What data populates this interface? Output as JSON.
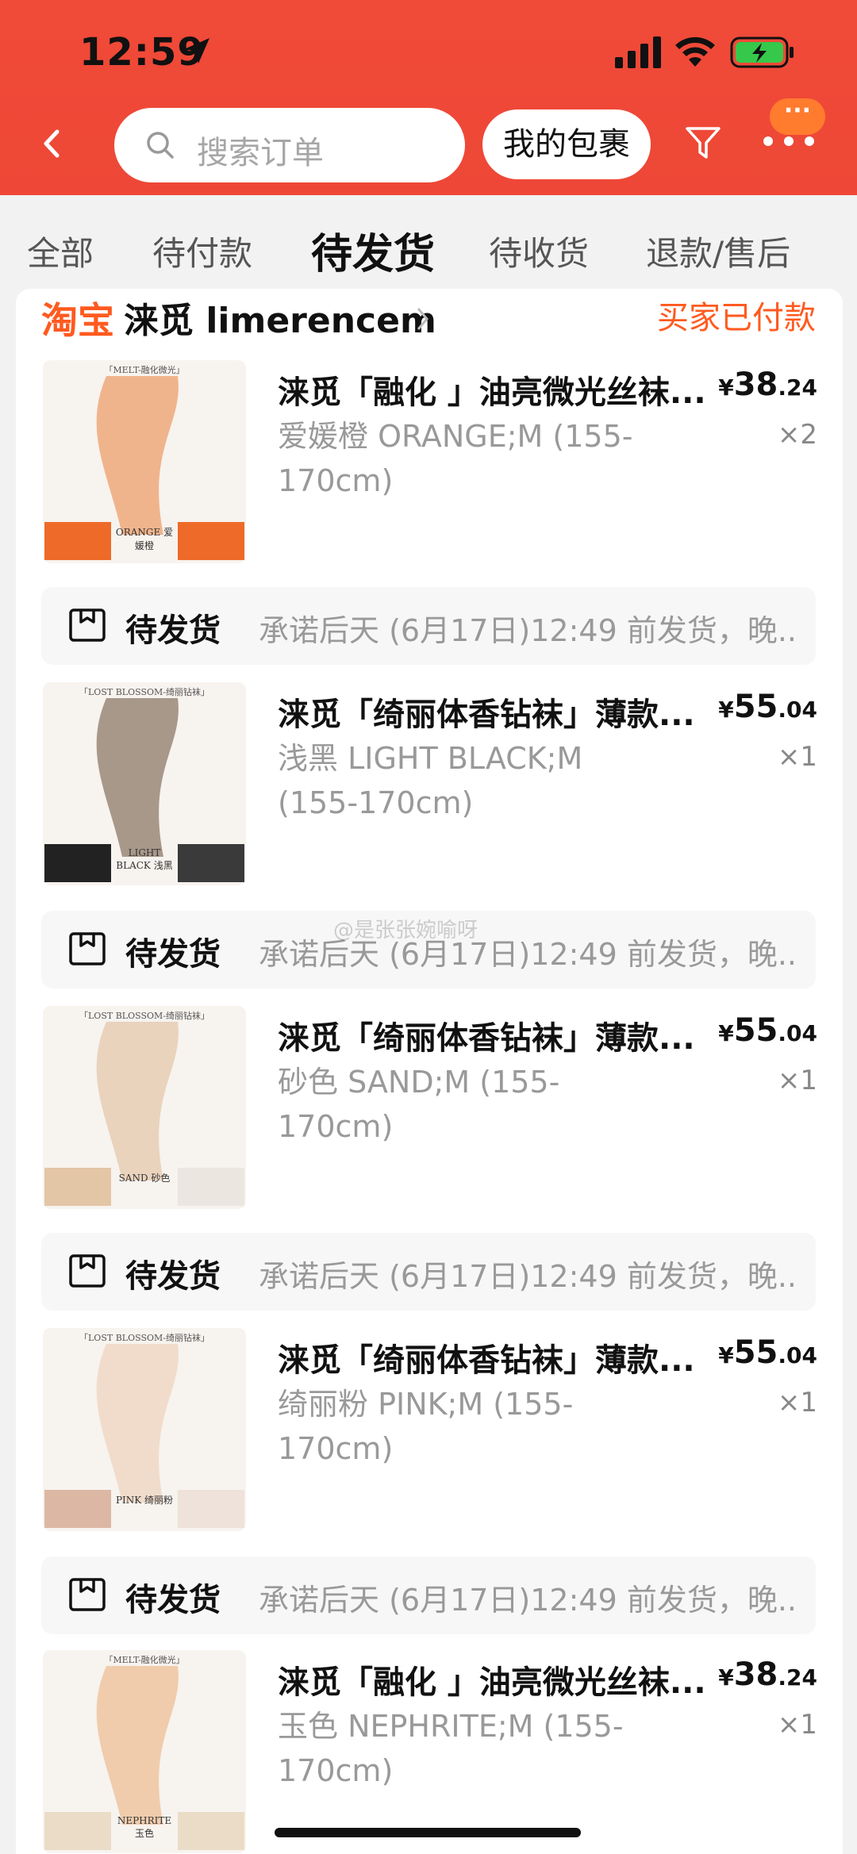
{
  "status_bar": {
    "time": "12:59"
  },
  "header": {
    "search_placeholder": "搜索订单",
    "package_button": "我的包裹",
    "more_badge": "···"
  },
  "tabs": [
    {
      "label": "全部"
    },
    {
      "label": "待付款"
    },
    {
      "label": "待发货",
      "active": true
    },
    {
      "label": "待收货"
    },
    {
      "label": "退款/售后"
    }
  ],
  "order": {
    "platform": "淘宝",
    "shop_name": "涞觅 limerencem",
    "status": "买家已付款",
    "items": [
      {
        "title": "涞觅「融化 」油亮微光丝袜...",
        "spec": "爱媛橙 ORANGE;M (155-170cm)",
        "currency": "¥",
        "price_int": "38",
        "price_dec": ".24",
        "qty": "×2",
        "thumb_top": "「MELT-融化微光」",
        "thumb_label": "ORANGE 爱媛橙",
        "swatch": "#ee6a28"
      },
      {
        "title": "涞觅「绮丽体香钻袜」薄款...",
        "spec": "浅黑 LIGHT BLACK;M (155-170cm)",
        "currency": "¥",
        "price_int": "55",
        "price_dec": ".04",
        "qty": "×1",
        "thumb_top": "「LOST BLOSSOM-绮丽钻袜」",
        "thumb_label": "LIGHT BLACK 浅黑",
        "swatch": "#222222"
      },
      {
        "title": "涞觅「绮丽体香钻袜」薄款...",
        "spec": "砂色 SAND;M (155-170cm)",
        "currency": "¥",
        "price_int": "55",
        "price_dec": ".04",
        "qty": "×1",
        "thumb_top": "「LOST BLOSSOM-绮丽钻袜」",
        "thumb_label": "SAND 砂色",
        "swatch": "#e3c6a6"
      },
      {
        "title": "涞觅「绮丽体香钻袜」薄款...",
        "spec": "绮丽粉 PINK;M (155-170cm)",
        "currency": "¥",
        "price_int": "55",
        "price_dec": ".04",
        "qty": "×1",
        "thumb_top": "「LOST BLOSSOM-绮丽钻袜」",
        "thumb_label": "PINK 绮丽粉",
        "swatch": "#dcb8a4"
      },
      {
        "title": "涞觅「融化 」油亮微光丝袜...",
        "spec": "玉色 NEPHRITE;M (155-170cm)",
        "currency": "¥",
        "price_int": "38",
        "price_dec": ".24",
        "qty": "×1",
        "thumb_top": "「MELT-融化微光」",
        "thumb_label": "NEPHRITE 玉色",
        "swatch": "#eadcc6"
      }
    ],
    "shipping": [
      {
        "label": "待发货",
        "note": "承诺后天 (6月17日)12:49 前发货，晚..."
      },
      {
        "label": "待发货",
        "note": "承诺后天 (6月17日)12:49 前发货，晚..."
      },
      {
        "label": "待发货",
        "note": "承诺后天 (6月17日)12:49 前发货，晚..."
      },
      {
        "label": "待发货",
        "note": "承诺后天 (6月17日)12:49 前发货，晚..."
      }
    ]
  },
  "watermark": "@是张张婉喻呀",
  "colors": {
    "header_bg": "#ee4737",
    "accent_orange": "#ff5a1f"
  }
}
